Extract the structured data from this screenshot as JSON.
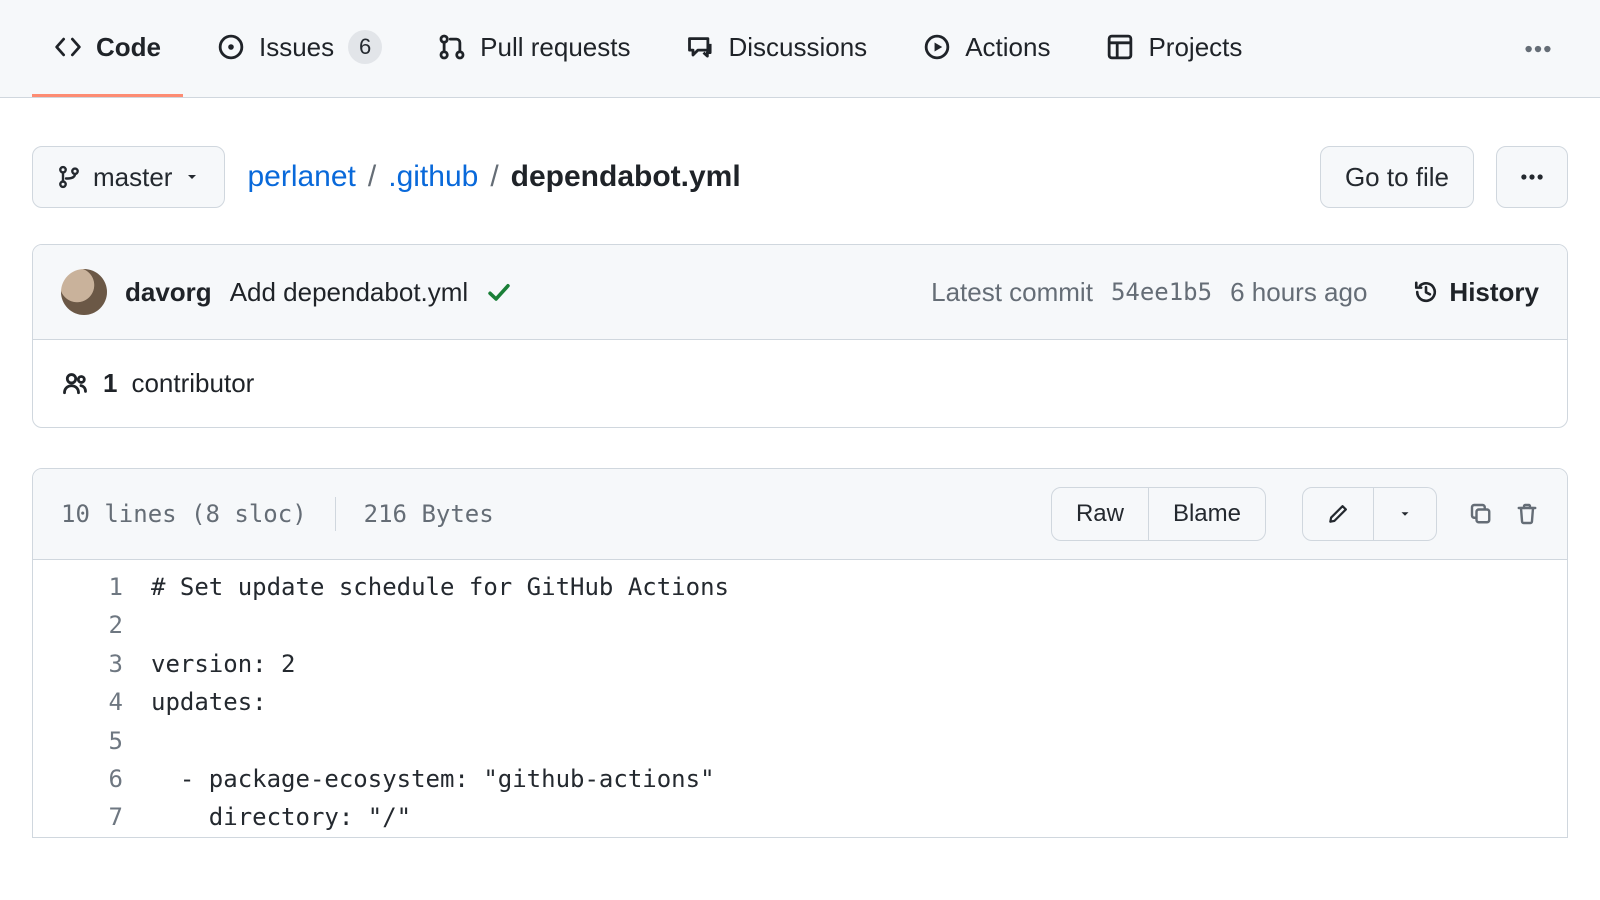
{
  "tabs": {
    "code": {
      "label": "Code"
    },
    "issues": {
      "label": "Issues",
      "count": "6"
    },
    "pulls": {
      "label": "Pull requests"
    },
    "discussions": {
      "label": "Discussions"
    },
    "actions": {
      "label": "Actions"
    },
    "projects": {
      "label": "Projects"
    }
  },
  "branch": {
    "name": "master"
  },
  "breadcrumb": {
    "root": "perlanet",
    "dir": ".github",
    "file": "dependabot.yml"
  },
  "actions_row": {
    "go_to_file": "Go to file"
  },
  "commit": {
    "author": "davorg",
    "message": "Add dependabot.yml",
    "latest_prefix": "Latest commit",
    "sha": "54ee1b5",
    "when": "6 hours ago",
    "history": "History"
  },
  "contributors": {
    "count": "1",
    "label": "contributor"
  },
  "blob": {
    "stats_lines": "10 lines (8 sloc)",
    "stats_bytes": "216 Bytes",
    "raw": "Raw",
    "blame": "Blame"
  },
  "code_lines": [
    "# Set update schedule for GitHub Actions",
    "",
    "version: 2",
    "updates:",
    "",
    "  - package-ecosystem: \"github-actions\"",
    "    directory: \"/\""
  ]
}
